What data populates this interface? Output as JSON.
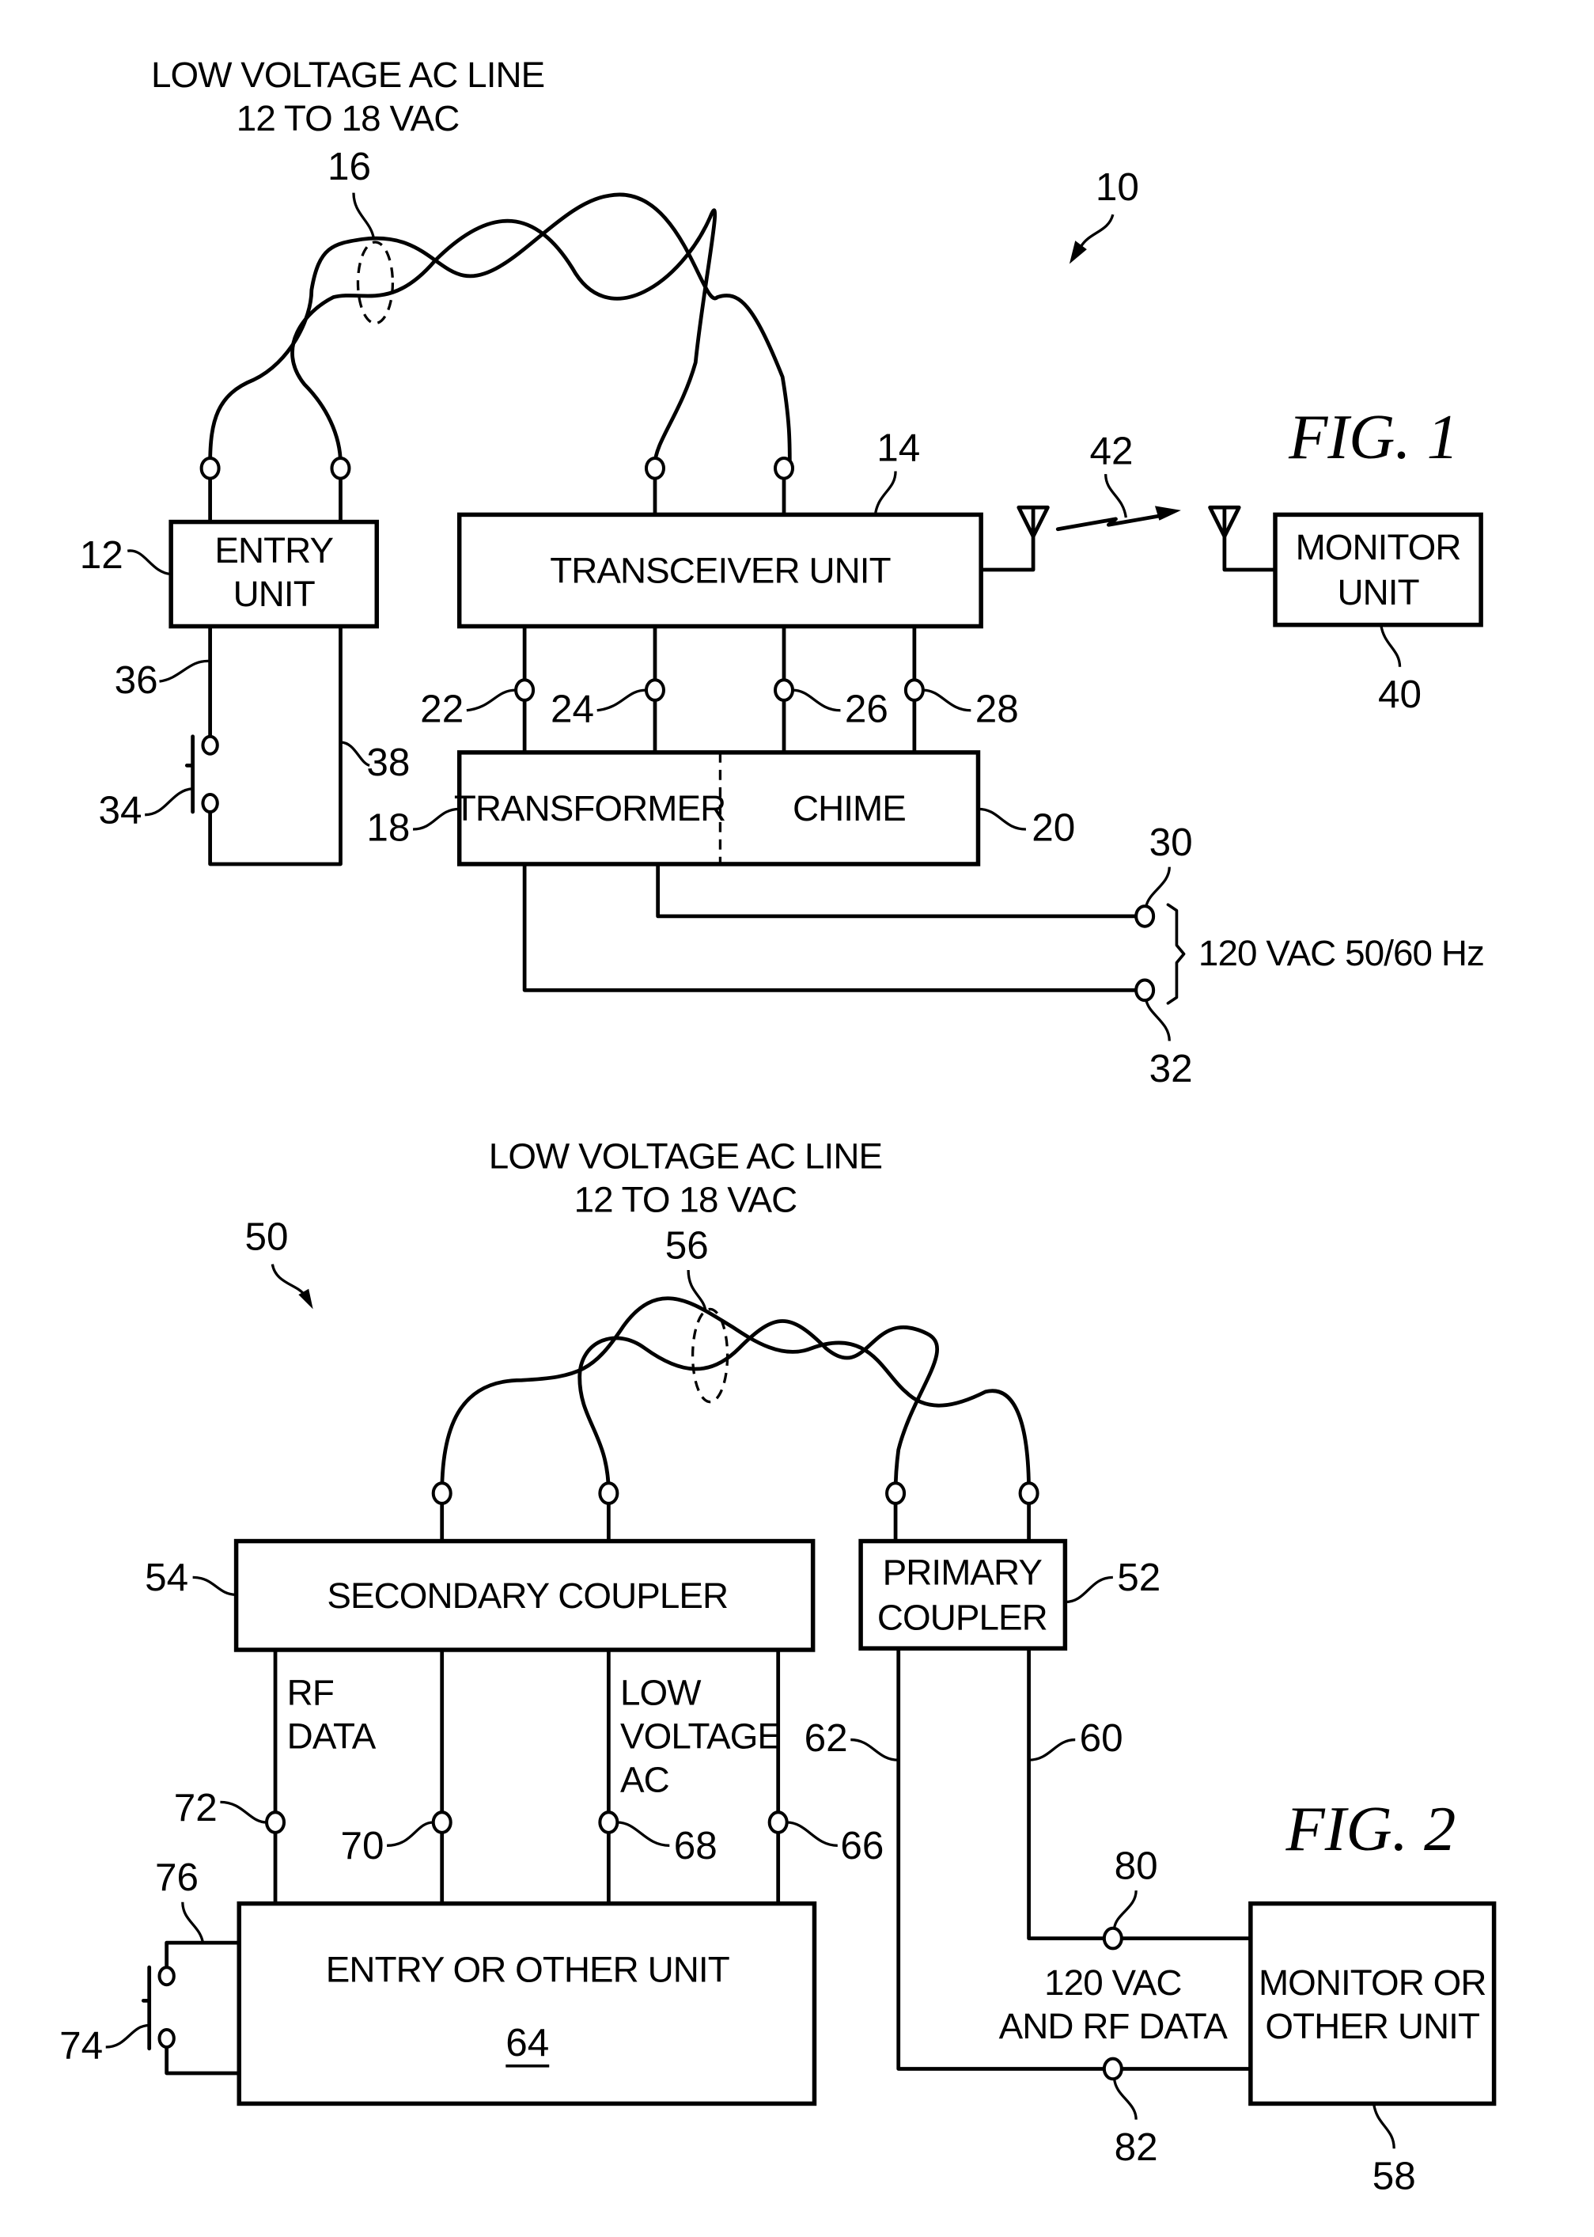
{
  "fig1": {
    "title": "FIG. 1",
    "system_ref": "10",
    "line_label": [
      "LOW VOLTAGE AC LINE",
      "12 TO 18 VAC"
    ],
    "line_ref": "16",
    "entry_unit": {
      "label": [
        "ENTRY",
        "UNIT"
      ],
      "ref": "12"
    },
    "transceiver_unit": {
      "label": "TRANSCEIVER UNIT",
      "ref": "14"
    },
    "monitor_unit": {
      "label": [
        "MONITOR",
        "UNIT"
      ],
      "ref": "40"
    },
    "wireless_link_ref": "42",
    "transformer": {
      "label": "TRANSFORMER",
      "ref": "18"
    },
    "chime": {
      "label": "CHIME",
      "ref": "20"
    },
    "terminal_refs": {
      "t22": "22",
      "t24": "24",
      "t26": "26",
      "t28": "28",
      "t30": "30",
      "t32": "32"
    },
    "switch_ref": "34",
    "wire_refs": {
      "w36": "36",
      "w38": "38"
    },
    "mains_label": "120 VAC 50/60 Hz"
  },
  "fig2": {
    "title": "FIG. 2",
    "system_ref": "50",
    "line_label": [
      "LOW VOLTAGE AC LINE",
      "12 TO 18 VAC"
    ],
    "line_ref": "56",
    "secondary_coupler": {
      "label": "SECONDARY COUPLER",
      "ref": "54"
    },
    "primary_coupler": {
      "label": [
        "PRIMARY",
        "COUPLER"
      ],
      "ref": "52"
    },
    "entry_or_other_unit": {
      "label": "ENTRY OR OTHER UNIT",
      "ref": "64"
    },
    "monitor_or_other_unit": {
      "label": [
        "MONITOR OR",
        "OTHER UNIT"
      ],
      "ref": "58"
    },
    "rf_data_label": [
      "RF",
      "DATA"
    ],
    "low_voltage_ac_label": [
      "LOW",
      "VOLTAGE",
      "AC"
    ],
    "mains_rf_label": [
      "120 VAC",
      "AND RF DATA"
    ],
    "terminal_refs": {
      "t66": "66",
      "t68": "68",
      "t70": "70",
      "t72": "72",
      "t80": "80",
      "t82": "82"
    },
    "wire_refs": {
      "w60": "60",
      "w62": "62",
      "w76": "76"
    },
    "switch_ref": "74"
  }
}
